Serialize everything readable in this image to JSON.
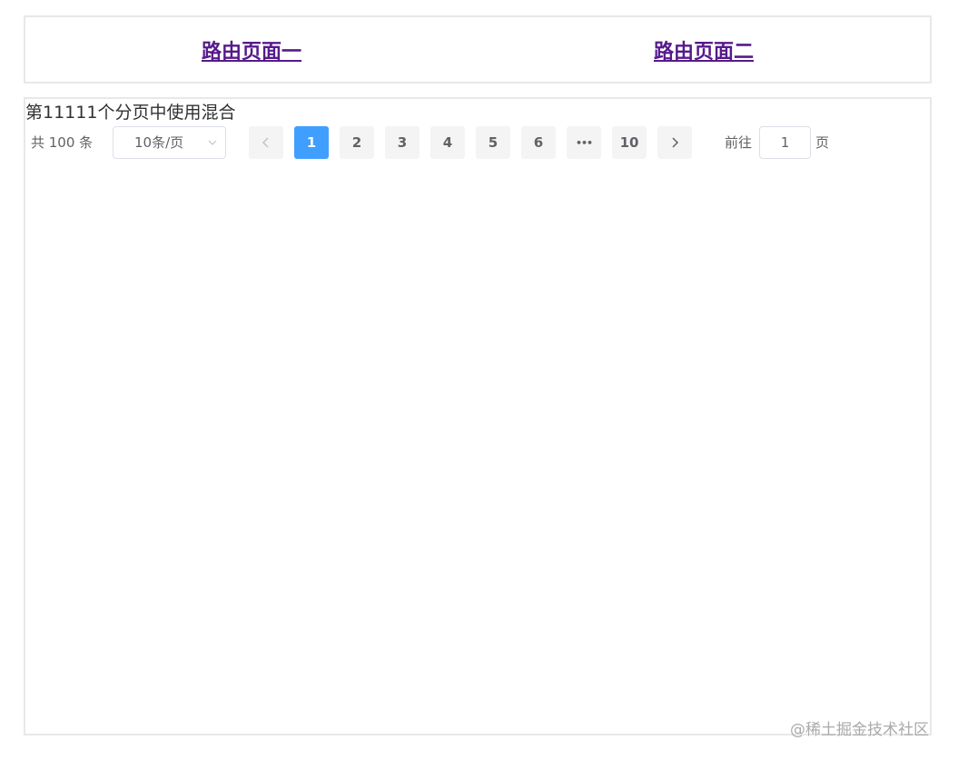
{
  "nav": {
    "link1": "路由页面一",
    "link2": "路由页面二"
  },
  "content": {
    "title": "第11111个分页中使用混合"
  },
  "pagination": {
    "total_text": "共 100 条",
    "page_size": "10条/页",
    "pages": [
      "1",
      "2",
      "3",
      "4",
      "5",
      "6"
    ],
    "ellipsis": "•••",
    "last_page": "10",
    "current_page": "1",
    "goto_label": "前往",
    "goto_value": "1",
    "goto_suffix": "页"
  },
  "watermark": "@稀土掘金技术社区",
  "colors": {
    "active": "#409eff",
    "button_bg": "#f4f4f5",
    "link": "#551a8b",
    "border": "#e8e8e8"
  }
}
